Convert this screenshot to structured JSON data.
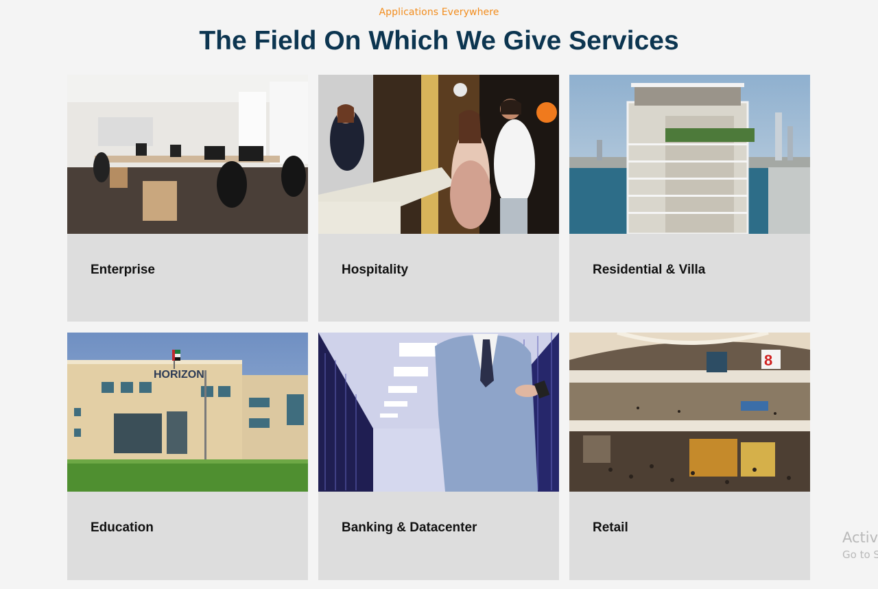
{
  "section": {
    "eyebrow": "Applications Everywhere",
    "title": "The Field On Which We Give Services"
  },
  "cards": [
    {
      "label": "Enterprise",
      "image": "office-photo"
    },
    {
      "label": "Hospitality",
      "image": "hotel-reception-photo"
    },
    {
      "label": "Residential & Villa",
      "image": "residential-tower-photo"
    },
    {
      "label": "Education",
      "image": "school-building-photo",
      "sign_text": "HORIZON"
    },
    {
      "label": "Banking & Datacenter",
      "image": "datacenter-photo"
    },
    {
      "label": "Retail",
      "image": "shopping-mall-photo",
      "sign_text": "8"
    }
  ],
  "watermark": {
    "line1": "Activ",
    "line2": "Go to S"
  }
}
